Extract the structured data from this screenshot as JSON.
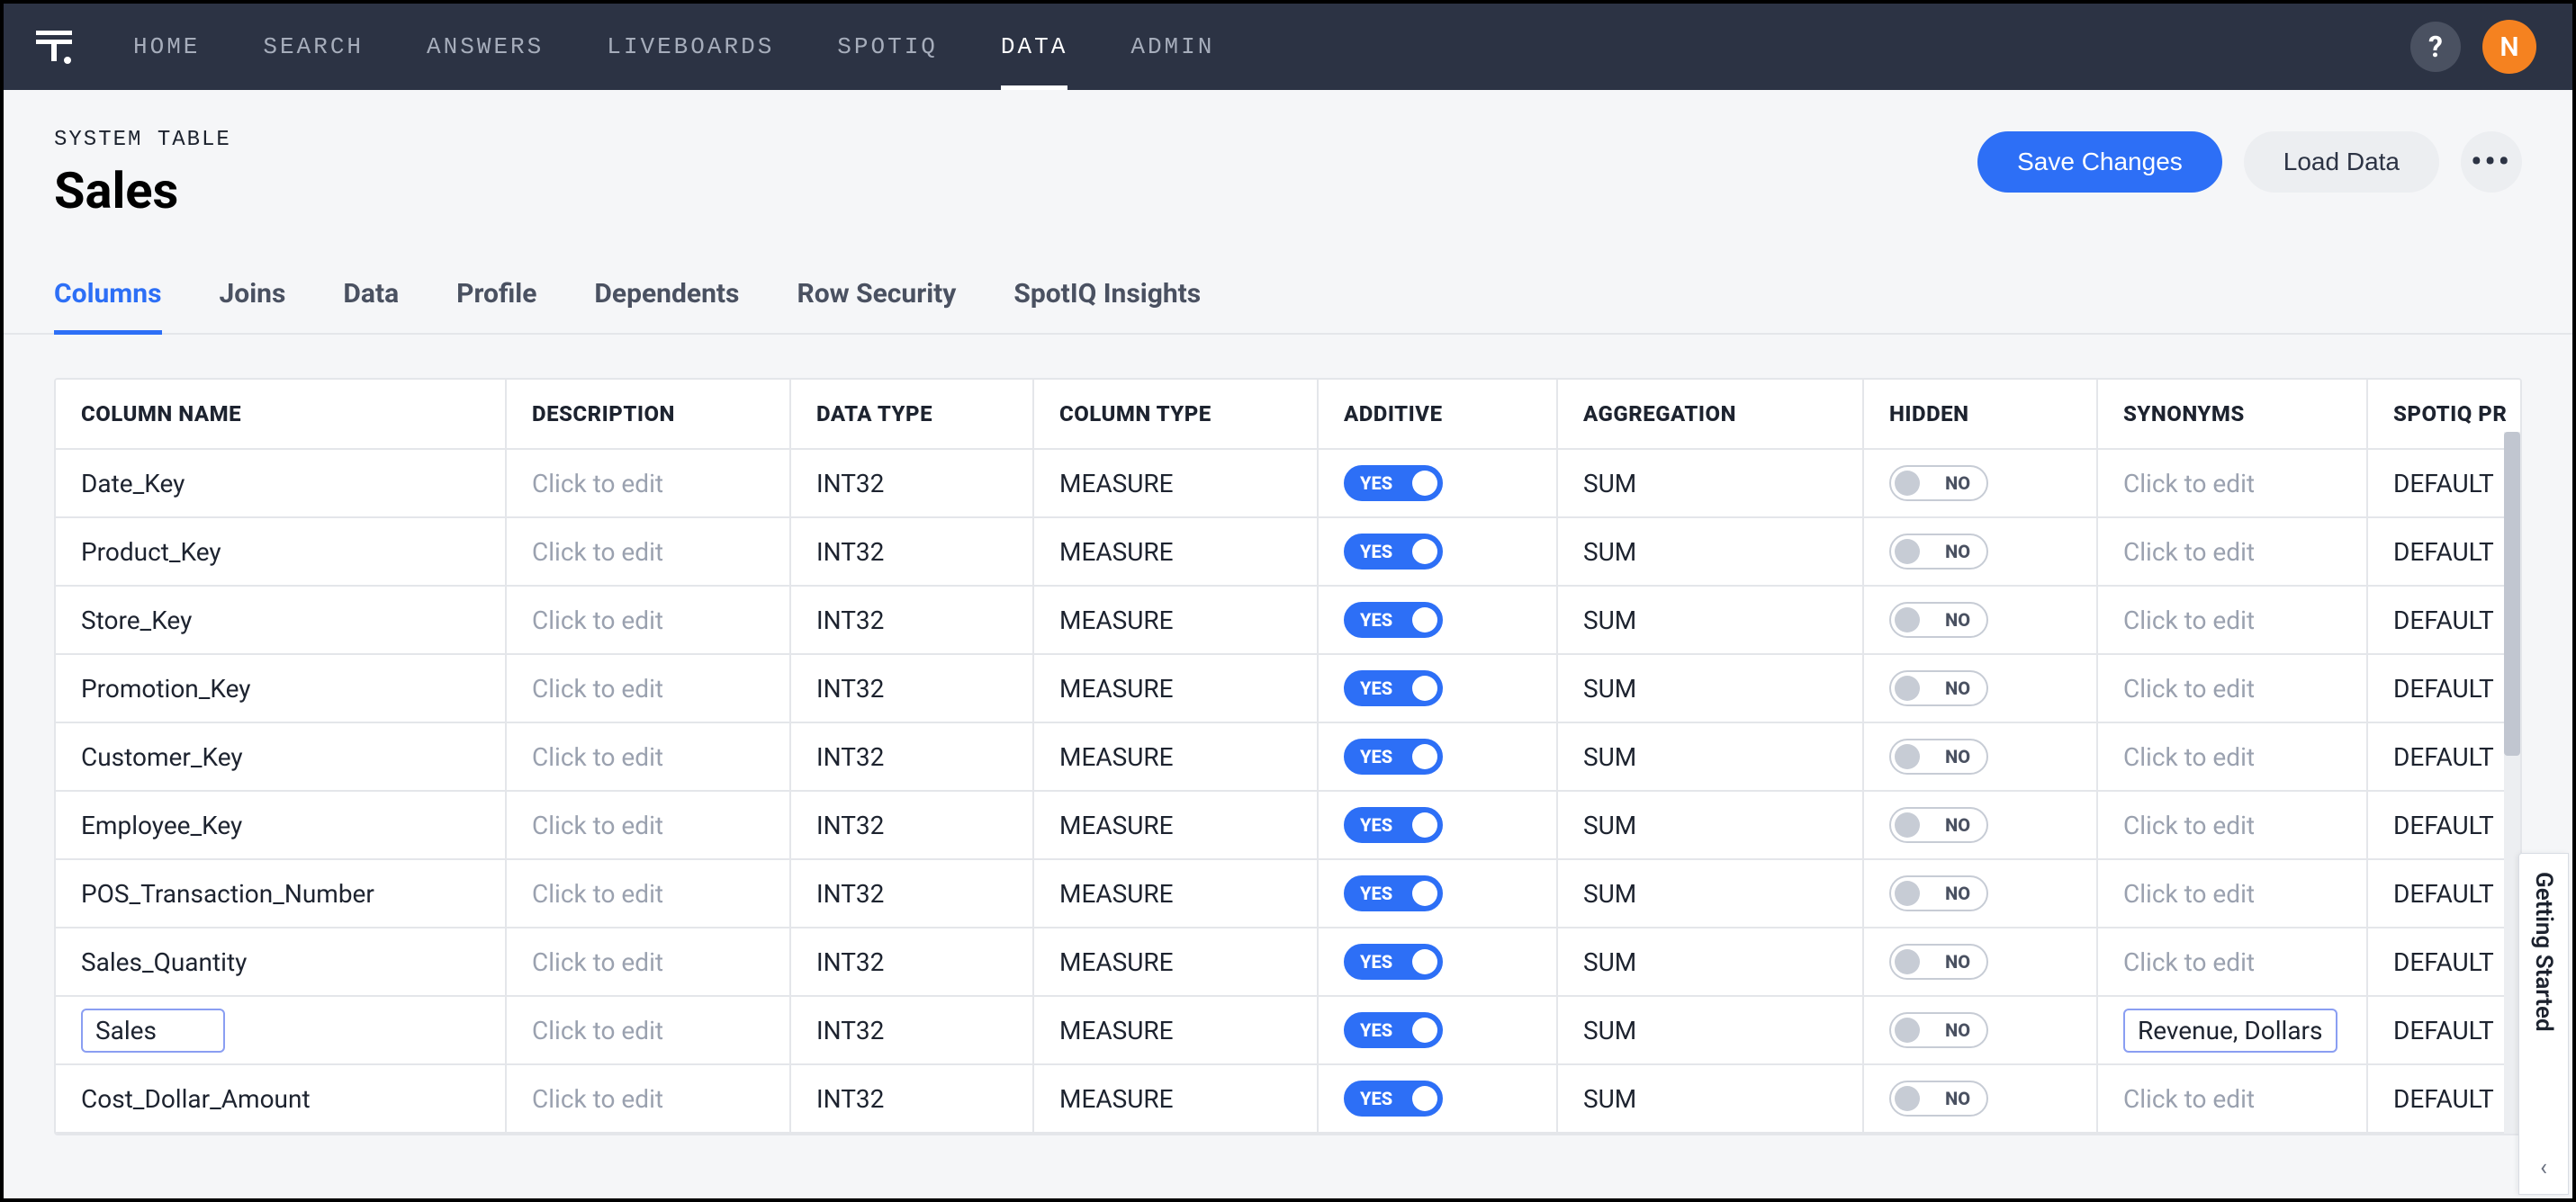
{
  "nav": {
    "items": [
      {
        "label": "HOME",
        "active": false
      },
      {
        "label": "SEARCH",
        "active": false
      },
      {
        "label": "ANSWERS",
        "active": false
      },
      {
        "label": "LIVEBOARDS",
        "active": false
      },
      {
        "label": "SPOTIQ",
        "active": false
      },
      {
        "label": "DATA",
        "active": true
      },
      {
        "label": "ADMIN",
        "active": false
      }
    ],
    "help_label": "?",
    "avatar_initial": "N"
  },
  "header": {
    "breadcrumb": "SYSTEM TABLE",
    "title": "Sales",
    "save_label": "Save Changes",
    "load_label": "Load Data"
  },
  "tabs": [
    {
      "label": "Columns",
      "active": true
    },
    {
      "label": "Joins",
      "active": false
    },
    {
      "label": "Data",
      "active": false
    },
    {
      "label": "Profile",
      "active": false
    },
    {
      "label": "Dependents",
      "active": false
    },
    {
      "label": "Row Security",
      "active": false
    },
    {
      "label": "SpotIQ Insights",
      "active": false
    }
  ],
  "table": {
    "placeholder_edit": "Click to edit",
    "toggle_yes": "YES",
    "toggle_no": "NO",
    "headers": {
      "column_name": "COLUMN NAME",
      "description": "DESCRIPTION",
      "data_type": "DATA TYPE",
      "column_type": "COLUMN TYPE",
      "additive": "ADDITIVE",
      "aggregation": "AGGREGATION",
      "hidden": "HIDDEN",
      "synonyms": "SYNONYMS",
      "spotiq": "SPOTIQ PR"
    },
    "rows": [
      {
        "name": "Date_Key",
        "data_type": "INT32",
        "column_type": "MEASURE",
        "additive": true,
        "aggregation": "SUM",
        "hidden": false,
        "synonyms": "",
        "spotiq": "DEFAULT",
        "name_editing": false,
        "syn_editing": false
      },
      {
        "name": "Product_Key",
        "data_type": "INT32",
        "column_type": "MEASURE",
        "additive": true,
        "aggregation": "SUM",
        "hidden": false,
        "synonyms": "",
        "spotiq": "DEFAULT",
        "name_editing": false,
        "syn_editing": false
      },
      {
        "name": "Store_Key",
        "data_type": "INT32",
        "column_type": "MEASURE",
        "additive": true,
        "aggregation": "SUM",
        "hidden": false,
        "synonyms": "",
        "spotiq": "DEFAULT",
        "name_editing": false,
        "syn_editing": false
      },
      {
        "name": "Promotion_Key",
        "data_type": "INT32",
        "column_type": "MEASURE",
        "additive": true,
        "aggregation": "SUM",
        "hidden": false,
        "synonyms": "",
        "spotiq": "DEFAULT",
        "name_editing": false,
        "syn_editing": false
      },
      {
        "name": "Customer_Key",
        "data_type": "INT32",
        "column_type": "MEASURE",
        "additive": true,
        "aggregation": "SUM",
        "hidden": false,
        "synonyms": "",
        "spotiq": "DEFAULT",
        "name_editing": false,
        "syn_editing": false
      },
      {
        "name": "Employee_Key",
        "data_type": "INT32",
        "column_type": "MEASURE",
        "additive": true,
        "aggregation": "SUM",
        "hidden": false,
        "synonyms": "",
        "spotiq": "DEFAULT",
        "name_editing": false,
        "syn_editing": false
      },
      {
        "name": "POS_Transaction_Number",
        "data_type": "INT32",
        "column_type": "MEASURE",
        "additive": true,
        "aggregation": "SUM",
        "hidden": false,
        "synonyms": "",
        "spotiq": "DEFAULT",
        "name_editing": false,
        "syn_editing": false
      },
      {
        "name": "Sales_Quantity",
        "data_type": "INT32",
        "column_type": "MEASURE",
        "additive": true,
        "aggregation": "SUM",
        "hidden": false,
        "synonyms": "",
        "spotiq": "DEFAULT",
        "name_editing": false,
        "syn_editing": false
      },
      {
        "name": "Sales",
        "data_type": "INT32",
        "column_type": "MEASURE",
        "additive": true,
        "aggregation": "SUM",
        "hidden": false,
        "synonyms": "Revenue, Dollars",
        "spotiq": "DEFAULT",
        "name_editing": true,
        "syn_editing": true
      },
      {
        "name": "Cost_Dollar_Amount",
        "data_type": "INT32",
        "column_type": "MEASURE",
        "additive": true,
        "aggregation": "SUM",
        "hidden": false,
        "synonyms": "",
        "spotiq": "DEFAULT",
        "name_editing": false,
        "syn_editing": false
      }
    ]
  },
  "side_panel": {
    "label": "Getting Started"
  }
}
